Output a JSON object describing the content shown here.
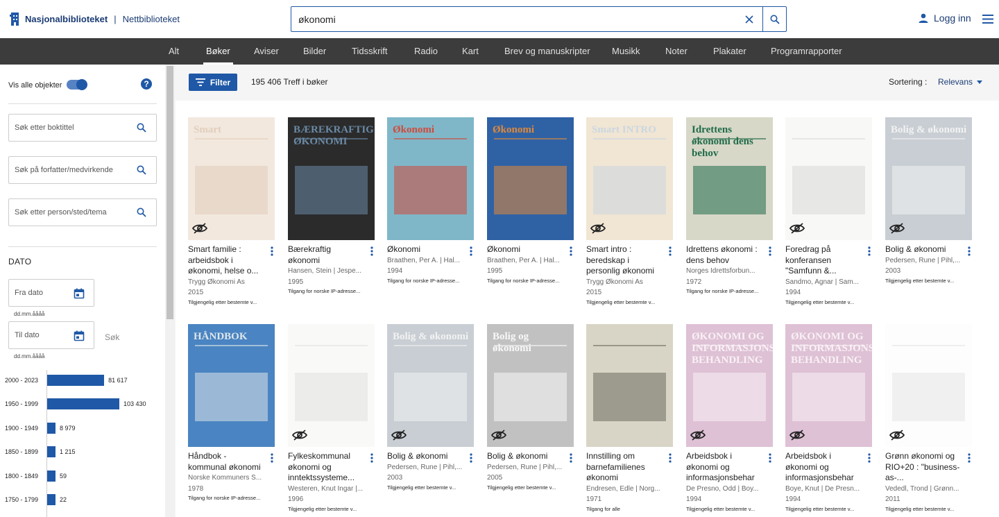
{
  "header": {
    "brand_name": "Nasjonalbiblioteket",
    "brand_sep": "|",
    "brand_sub": "Nettbiblioteket",
    "search_value": "økonomi",
    "login_label": "Logg inn"
  },
  "nav": [
    "Alt",
    "Bøker",
    "Aviser",
    "Bilder",
    "Tidsskrift",
    "Radio",
    "Kart",
    "Brev og manuskripter",
    "Musikk",
    "Noter",
    "Plakater",
    "Programrapporter"
  ],
  "nav_active": "Bøker",
  "sidebar": {
    "toggle_label": "Vis alle objekter",
    "help": "?",
    "search_title_placeholder": "Søk etter boktittel",
    "search_author_placeholder": "Søk på forfatter/medvirkende",
    "search_subject_placeholder": "Søk etter person/sted/tema",
    "dato_title": "DATO",
    "from_placeholder": "Fra dato",
    "to_placeholder": "Til dato",
    "date_hint": "dd.mm.åååå",
    "sok_label": "Søk",
    "histogram": [
      {
        "label": "2000 - 2023",
        "value": 81617,
        "display": "81 617"
      },
      {
        "label": "1950 - 1999",
        "value": 103430,
        "display": "103 430"
      },
      {
        "label": "1900 - 1949",
        "value": 8979,
        "display": "8 979"
      },
      {
        "label": "1850 - 1899",
        "value": 1215,
        "display": "1 215"
      },
      {
        "label": "1800 - 1849",
        "value": 59,
        "display": "59"
      },
      {
        "label": "1750 - 1799",
        "value": 22,
        "display": "22"
      }
    ]
  },
  "toolbar": {
    "filter_label": "Filter",
    "hits": "195 406 Treff i bøker",
    "sort_label": "Sortering :",
    "sort_value": "Relevans"
  },
  "results": [
    {
      "title": "Smart familie : arbeidsbok i økonomi, helse o...",
      "author": "Trygg Økonomi As",
      "year": "2015",
      "access": "Tilgjengelig etter bestemte v...",
      "hidden": true,
      "bg": "#e8d6c4",
      "fg": "#c9a684",
      "text": "Smart"
    },
    {
      "title": "Bærekraftig økonomi",
      "author": "Hansen, Stein | Jespe...",
      "year": "1995",
      "access": "Tilgang for norske IP-adresse...",
      "hidden": false,
      "bg": "#2b2b2b",
      "fg": "#6a8aa6",
      "text": "BÆREKRAFTIG ØKONOMI"
    },
    {
      "title": "Økonomi",
      "author": "Braathen, Per A. | Hal...",
      "year": "1994",
      "access": "Tilgang for norske IP-adresse...",
      "hidden": false,
      "bg": "#7fb7c9",
      "fg": "#d04a3a",
      "text": "Økonomi"
    },
    {
      "title": "Økonomi",
      "author": "Braathen, Per A. | Hal...",
      "year": "1995",
      "access": "Tilgang for norske IP-adresse...",
      "hidden": false,
      "bg": "#2f62a5",
      "fg": "#e0883a",
      "text": "Økonomi"
    },
    {
      "title": "Smart intro : beredskap i personlig økonomi",
      "author": "Trygg Økonomi As",
      "year": "2015",
      "access": "Tilgjengelig etter bestemte v...",
      "hidden": true,
      "bg": "#e6d2b0",
      "fg": "#9fb4c9",
      "text": "Smart INTRO"
    },
    {
      "title": "Idrettens økonomi : dens behov",
      "author": "Norges Idrettsforbun...",
      "year": "1972",
      "access": "Tilgang for norske IP-adresse...",
      "hidden": false,
      "bg": "#d8d8c8",
      "fg": "#1f6b4a",
      "text": "Idrettens økonomi dens behov"
    },
    {
      "title": "Foredrag på konferansen \"Samfunn &...",
      "author": "Sandmo, Agnar | Sam...",
      "year": "1994",
      "access": "Tilgjengelig etter bestemte v...",
      "hidden": true,
      "bg": "#f2f2ee",
      "fg": "#bbbbbb",
      "text": ""
    },
    {
      "title": "Bolig & økonomi",
      "author": "Pedersen, Rune | Pihl,...",
      "year": "2003",
      "access": "Tilgjengelig etter bestemte v...",
      "hidden": true,
      "bg": "#9ca6b0",
      "fg": "#e8e8e8",
      "text": "Bolig & økonomi"
    },
    {
      "title": "Håndbok - kommunal økonomi",
      "author": "Norske Kommuners S...",
      "year": "1978",
      "access": "Tilgang for norske IP-adresse...",
      "hidden": false,
      "bg": "#4a84c2",
      "fg": "#dfe6ea",
      "text": "HÅNDBOK"
    },
    {
      "title": "Fylkeskommunal økonomi og inntektssysteme...",
      "author": "Westeren, Knut Ingar |...",
      "year": "1996",
      "access": "Tilgjengelig etter bestemte v...",
      "hidden": true,
      "bg": "#f4f4f2",
      "fg": "#c8c8c8",
      "text": ""
    },
    {
      "title": "Bolig & økonomi",
      "author": "Pedersen, Rune | Pihl,...",
      "year": "2003",
      "access": "Tilgjengelig etter bestemte v...",
      "hidden": true,
      "bg": "#9ca6b0",
      "fg": "#e8e8e8",
      "text": "Bolig & økonomi"
    },
    {
      "title": "Bolig & økonomi",
      "author": "Pedersen, Rune | Pihl,...",
      "year": "2005",
      "access": "Tilgjengelig etter bestemte v...",
      "hidden": true,
      "bg": "#8e8e8e",
      "fg": "#f2f2f2",
      "text": "Bolig og økonomi"
    },
    {
      "title": "Innstilling om barnefamilienes økonomi",
      "author": "Endresen, Edle | Norg...",
      "year": "1971",
      "access": "Tilgang for alle",
      "hidden": false,
      "bg": "#d9d5c6",
      "fg": "#6c6a60",
      "text": ""
    },
    {
      "title": "Arbeidsbok i økonomi og informasjonsbehar",
      "author": "De Presno, Odd | Boy...",
      "year": "1994",
      "access": "Tilgjengelig etter bestemte v...",
      "hidden": true,
      "bg": "#c48fb3",
      "fg": "#f5e6ef",
      "text": "ØKONOMI OG INFORMASJONS-BEHANDLING"
    },
    {
      "title": "Arbeidsbok i økonomi og informasjonsbehar",
      "author": "Boye, Knut | De Presn...",
      "year": "1994",
      "access": "Tilgjengelig etter bestemte v...",
      "hidden": true,
      "bg": "#c48fb3",
      "fg": "#f5e6ef",
      "text": "ØKONOMI OG INFORMASJONS-BEHANDLING"
    },
    {
      "title": "Grønn økonomi og RIO+20 : \"business-as-...",
      "author": "Vededl, Trond | Grønn...",
      "year": "2011",
      "access": "Tilgjengelig etter bestemte v...",
      "hidden": true,
      "bg": "#fbfbfb",
      "fg": "#cfcfcf",
      "text": ""
    }
  ]
}
